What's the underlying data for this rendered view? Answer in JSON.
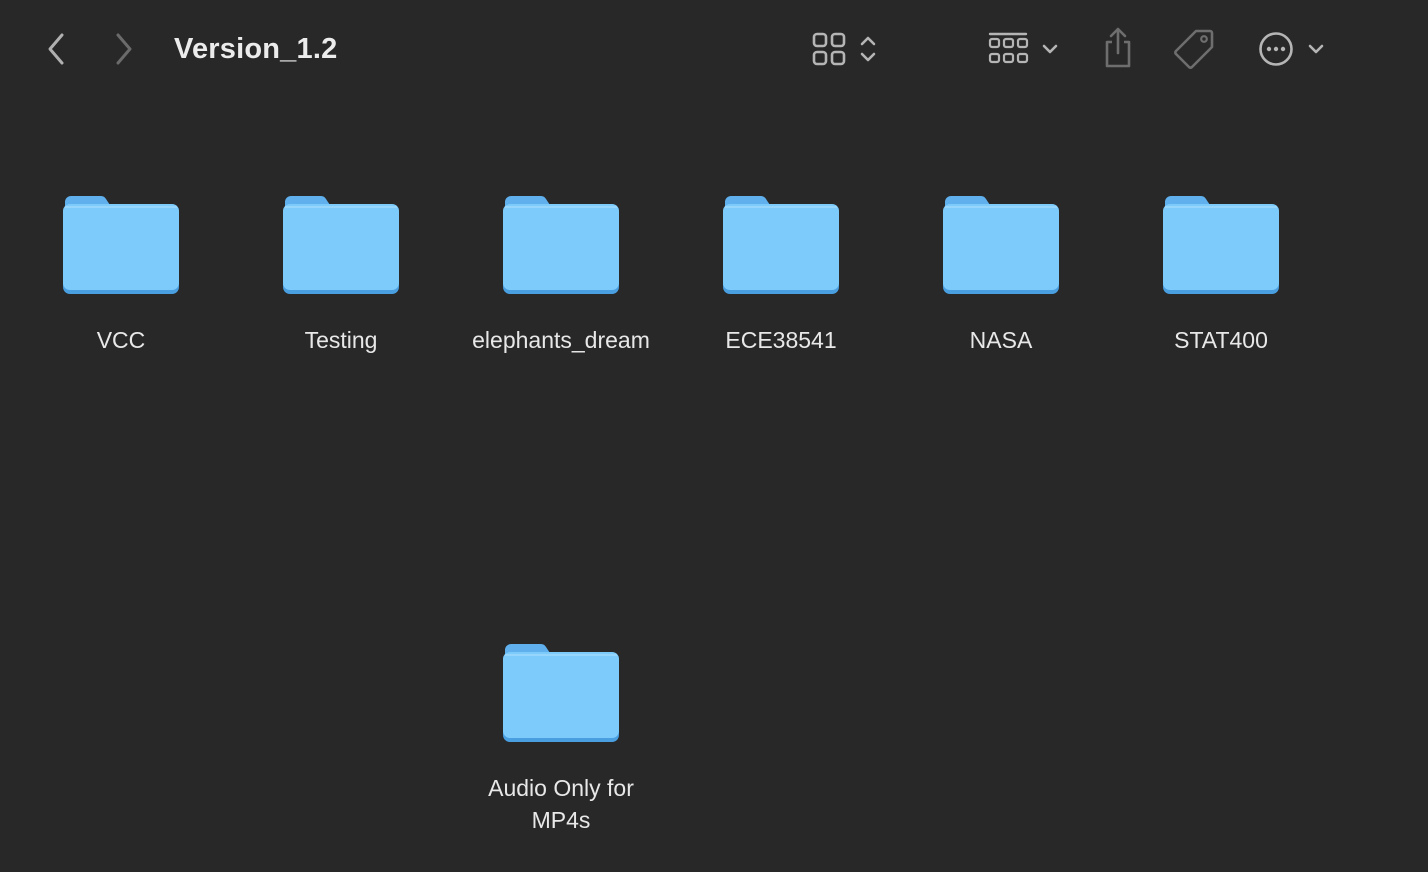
{
  "window": {
    "title": "Version_1.2"
  },
  "toolbar": {
    "back_icon": "chevron-left-icon",
    "forward_icon": "chevron-right-icon",
    "view_icon": "icon-grid-view-icon",
    "group_icon": "group-by-icon",
    "share_icon": "share-icon",
    "tag_icon": "tag-icon",
    "more_icon": "ellipsis-circle-icon"
  },
  "colors": {
    "background": "#282828",
    "folder_front": "#7dcbfa",
    "folder_back": "#5fb0ec",
    "toolbar_icon": "#b5b5b5",
    "toolbar_icon_disabled": "#6b6b6b"
  },
  "folders": [
    {
      "name": "VCC"
    },
    {
      "name": "Testing"
    },
    {
      "name": "elephants_dream"
    },
    {
      "name": "ECE38541"
    },
    {
      "name": "NASA"
    },
    {
      "name": "STAT400"
    },
    {
      "name": "Audio Only for MP4s"
    }
  ]
}
